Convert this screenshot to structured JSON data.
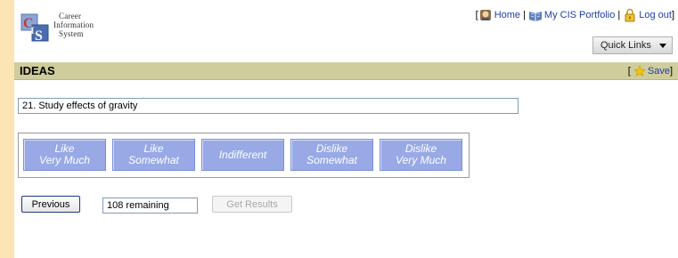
{
  "logo": {
    "line1": "Career",
    "line2": "Information",
    "line3": "System"
  },
  "topnav": {
    "bracket_open": "[",
    "home": "Home",
    "portfolio": "My CIS Portfolio",
    "logout": "Log out",
    "bracket_close": "]",
    "separator": "|"
  },
  "quick_links": {
    "label": "Quick Links"
  },
  "section": {
    "title": "IDEAS",
    "save_open": "[",
    "save": "Save",
    "save_close": "]"
  },
  "idea": {
    "text": "21. Study effects of gravity"
  },
  "ratings": [
    {
      "line1": "Like",
      "line2": "Very Much"
    },
    {
      "line1": "Like",
      "line2": "Somewhat"
    },
    {
      "line1": "Indifferent",
      "line2": ""
    },
    {
      "line1": "Dislike",
      "line2": "Somewhat"
    },
    {
      "line1": "Dislike",
      "line2": "Very Much"
    }
  ],
  "controls": {
    "previous": "Previous",
    "remaining": "108 remaining",
    "get_results": "Get Results"
  },
  "colors": {
    "page_background": "#fde4b4",
    "band": "#cfcd9b",
    "rating_button": "#98a9e6",
    "link": "#1f3fa6"
  },
  "icons": [
    "cis-logo-icon",
    "home-icon",
    "portfolio-icon",
    "logout-lock-icon",
    "star-icon",
    "chevron-down-icon"
  ]
}
